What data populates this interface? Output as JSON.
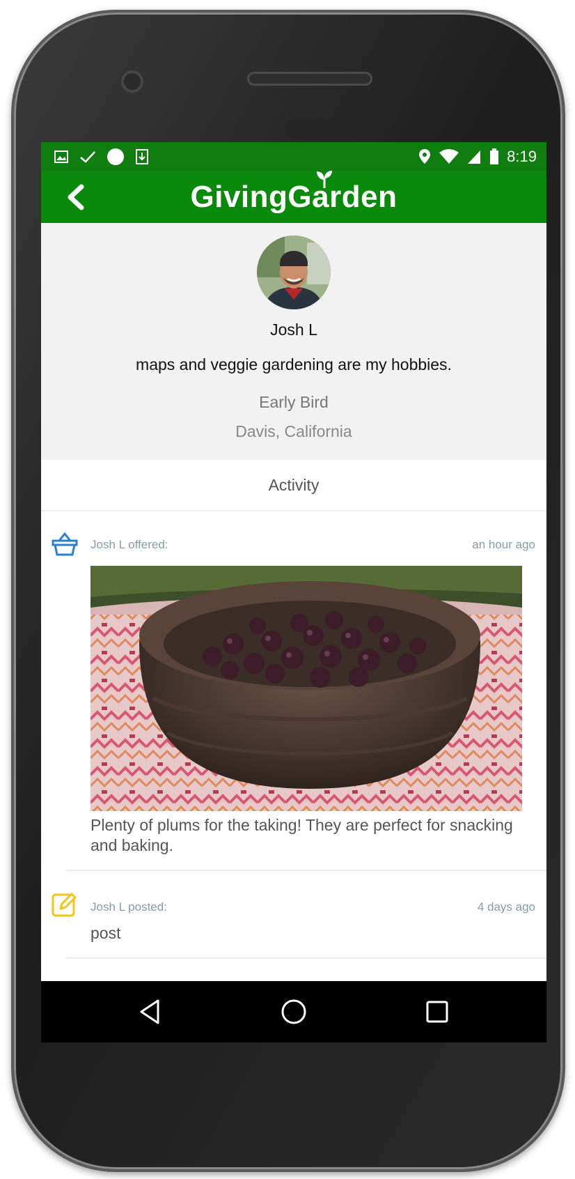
{
  "status_bar": {
    "time": "8:19",
    "left_icons": [
      "image-icon",
      "check-icon",
      "circle-icon",
      "sim-download-icon"
    ],
    "right_icons": [
      "location-icon",
      "wifi-icon",
      "signal-icon",
      "battery-icon"
    ]
  },
  "app_bar": {
    "title": "GivingGarden",
    "back_icon": "chevron-left-icon"
  },
  "profile": {
    "name": "Josh L",
    "bio": "maps and veggie gardening are my hobbies.",
    "rank": "Early Bird",
    "location": "Davis, California"
  },
  "tabs": {
    "activity": "Activity"
  },
  "feed": [
    {
      "icon": "basket-icon",
      "author": "Josh L offered:",
      "time": "an hour ago",
      "description": "Plenty of plums for the taking! They are perfect for snacking and baking."
    },
    {
      "icon": "edit-icon",
      "author": "Josh L posted:",
      "time": "4 days ago",
      "text": "post"
    }
  ],
  "colors": {
    "status_bar": "#0f7d0f",
    "app_bar": "#0a8a0a",
    "offer_icon": "#2a7fd4",
    "post_icon": "#f0c419"
  }
}
